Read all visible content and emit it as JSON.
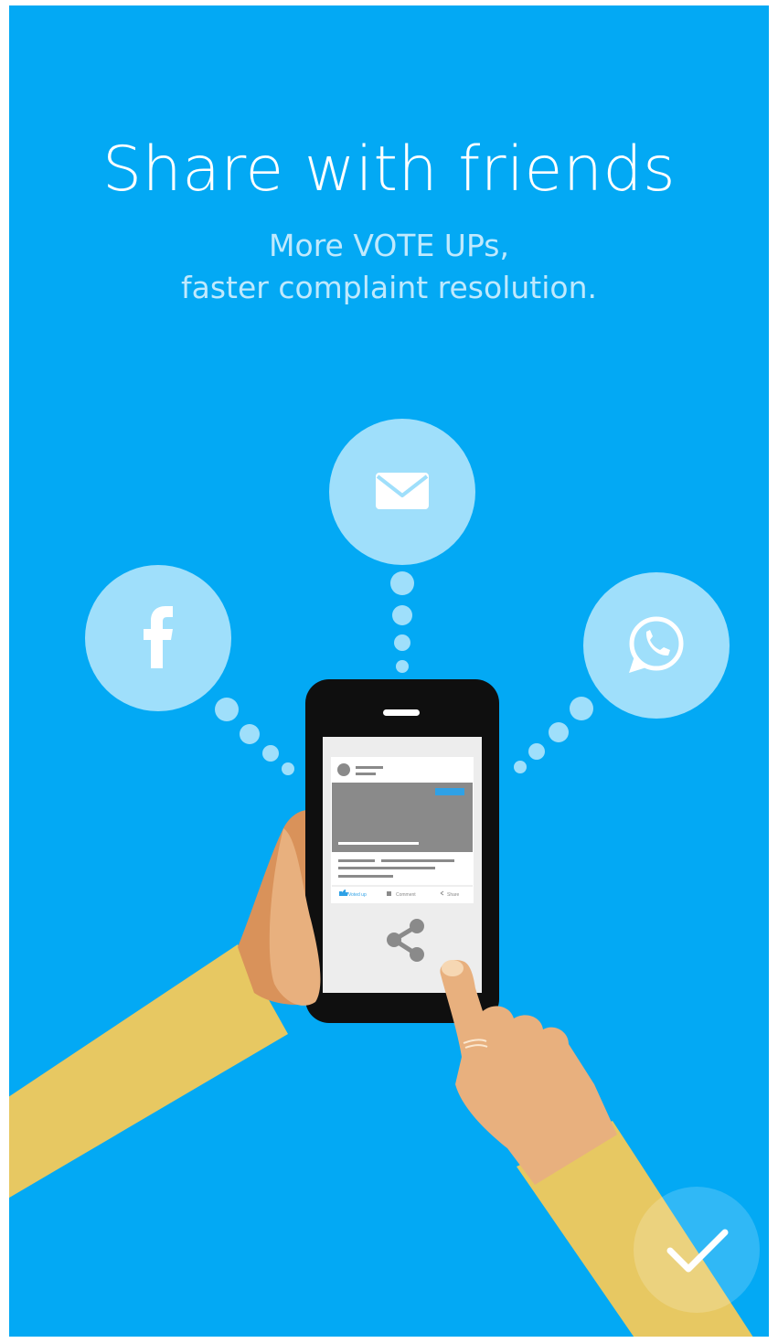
{
  "onboarding": {
    "title": "Share with friends",
    "subtitle_line1": "More VOTE UPs,",
    "subtitle_line2": "faster complaint resolution."
  },
  "phone_post": {
    "voted_label": "Voted up",
    "comment_label": "Comment",
    "share_label": "Share"
  },
  "share_targets": [
    "email-icon",
    "facebook-icon",
    "whatsapp-icon"
  ],
  "done_button": {
    "icon": "check-icon"
  },
  "colors": {
    "background": "#03A9F4",
    "bubble": "#9FDFFB",
    "sleeve": "#E7C862",
    "skin": "#E8B07E",
    "phone_body": "#0F0F0F"
  }
}
